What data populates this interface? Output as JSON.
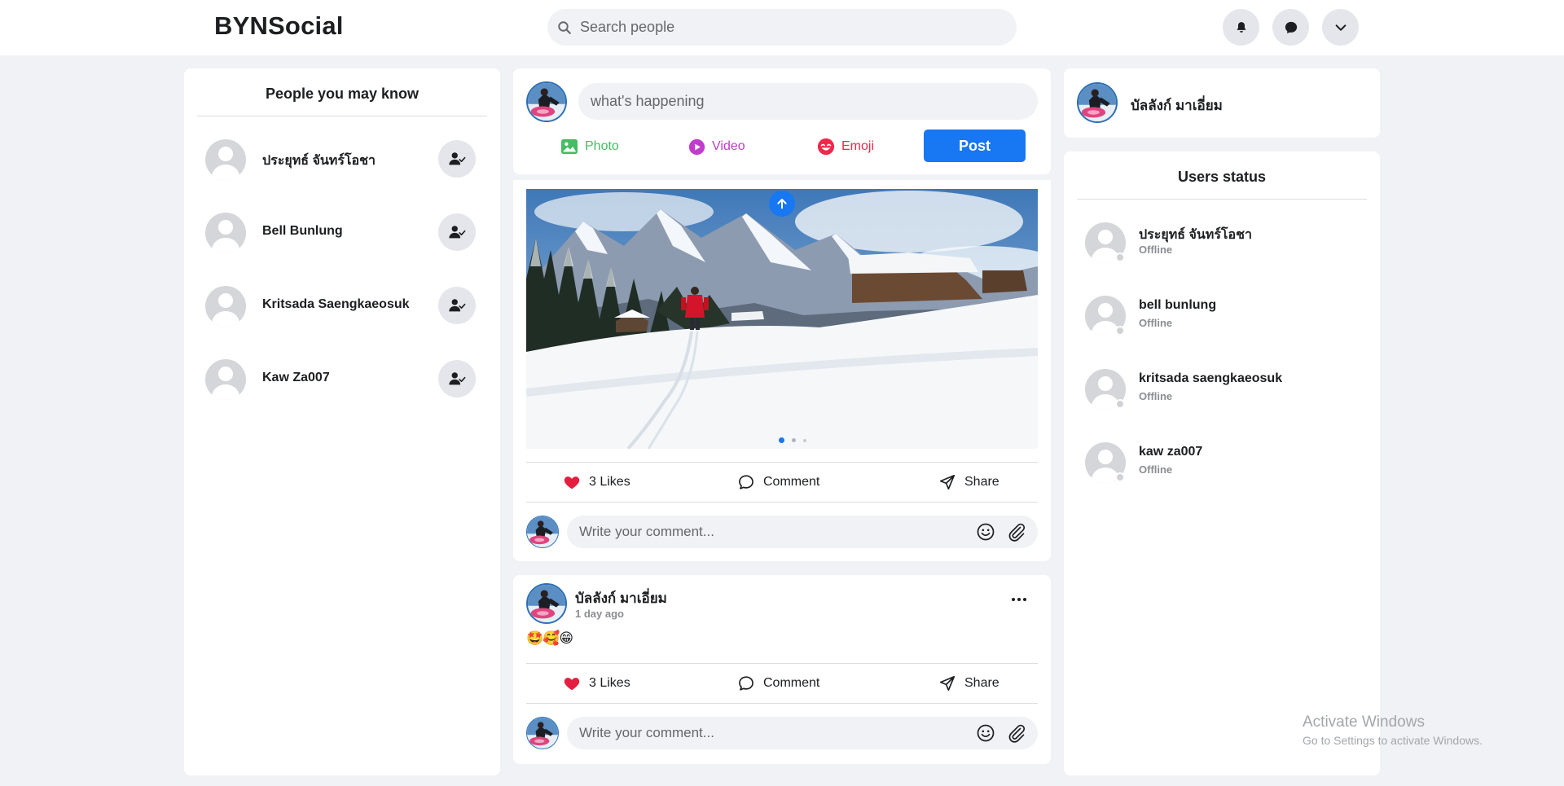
{
  "header": {
    "logo": "BYNSocial",
    "search_placeholder": "Search people"
  },
  "icons": {
    "notifications": "bell-icon",
    "messages": "chat-icon",
    "menu": "chevron-down-icon"
  },
  "people_you_may_know": {
    "title": "People you may know",
    "people": [
      {
        "name": "ประยุทธ์ จันทร์โอชา"
      },
      {
        "name": "Bell Bunlung"
      },
      {
        "name": "Kritsada Saengkaeosuk"
      },
      {
        "name": "Kaw Za007"
      }
    ]
  },
  "composer": {
    "placeholder": "what's happening",
    "photo_label": "Photo",
    "video_label": "Video",
    "emoji_label": "Emoji",
    "post_label": "Post",
    "colors": {
      "photo": "#45bd62",
      "video": "#c03ccb",
      "emoji": "#f02849",
      "post": "#1877f2"
    }
  },
  "posts": [
    {
      "image_carousel": {
        "slides": 3,
        "active_slide": 1
      },
      "likes_label": "3 Likes",
      "comment_label": "Comment",
      "share_label": "Share",
      "comment_placeholder": "Write your comment..."
    },
    {
      "author": "บัลลังก์ มาเอี่ยม",
      "time": "1 day ago",
      "content": "🤩🥰😁",
      "likes_label": "3 Likes",
      "comment_label": "Comment",
      "share_label": "Share",
      "comment_placeholder": "Write your comment..."
    }
  ],
  "profile": {
    "name": "บัลลังก์ มาเอี่ยม"
  },
  "users_status": {
    "title": "Users status",
    "users": [
      {
        "name": "ประยุทธ์ จันทร์โอชา",
        "status": "Offline"
      },
      {
        "name": "bell bunlung",
        "status": "Offline"
      },
      {
        "name": "kritsada saengkaeosuk",
        "status": "Offline"
      },
      {
        "name": "kaw za007",
        "status": "Offline"
      }
    ]
  },
  "watermark": {
    "title": "Activate Windows",
    "subtitle": "Go to Settings to activate Windows."
  }
}
